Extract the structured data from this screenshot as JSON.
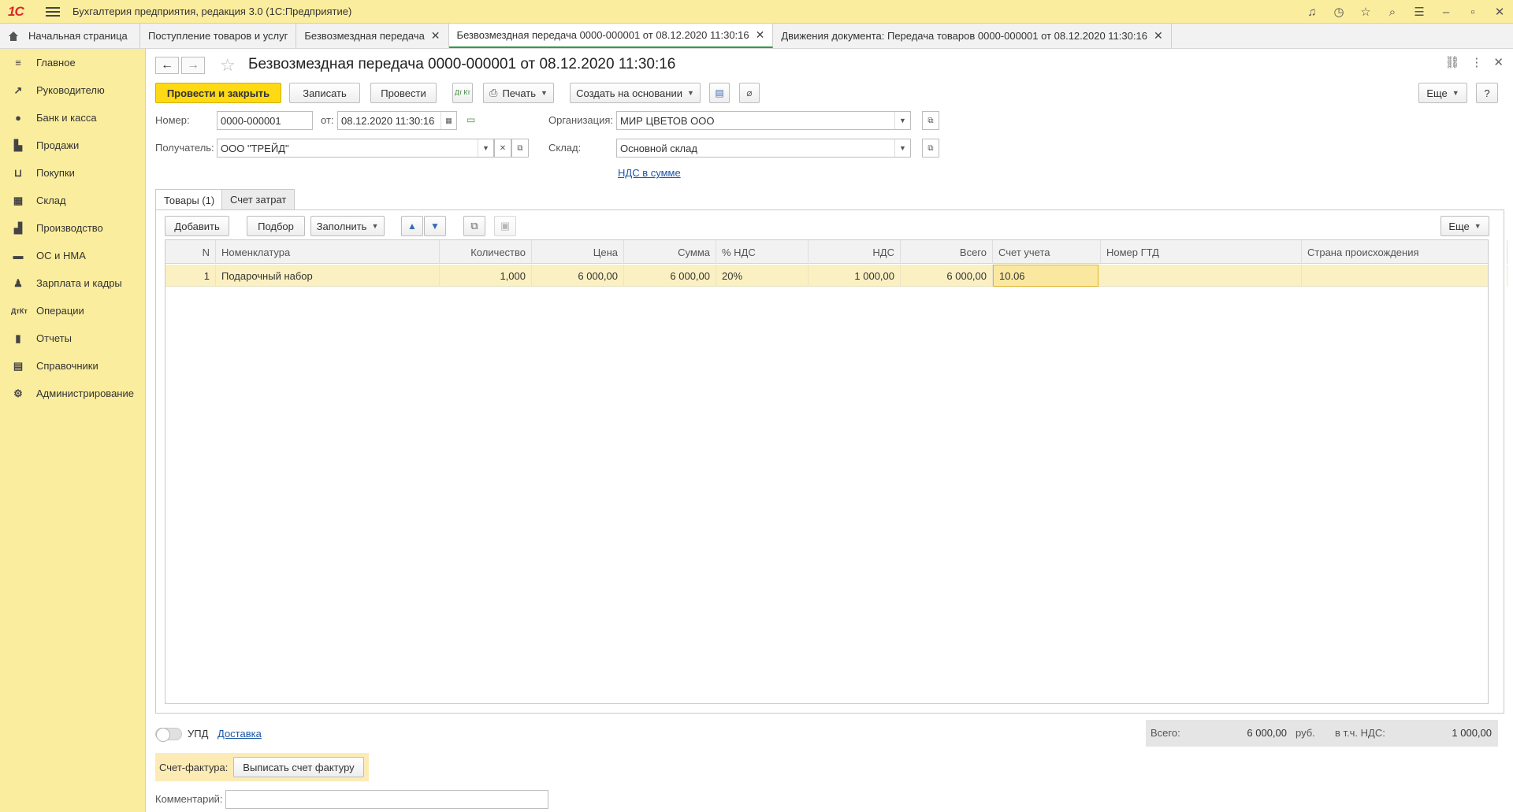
{
  "app": {
    "title": "Бухгалтерия предприятия, редакция 3.0  (1С:Предприятие)",
    "logo": "1С"
  },
  "tabs": [
    {
      "label": "Начальная страница"
    },
    {
      "label": "Поступление товаров и услуг"
    },
    {
      "label": "Безвозмездная передача"
    },
    {
      "label": "Безвозмездная передача 0000-000001 от 08.12.2020 11:30:16"
    },
    {
      "label": "Движения документа: Передача товаров 0000-000001 от 08.12.2020 11:30:16"
    }
  ],
  "sidebar": {
    "items": [
      {
        "label": "Главное",
        "icon": "menu-icon"
      },
      {
        "label": "Руководителю",
        "icon": "trend-icon"
      },
      {
        "label": "Банк и касса",
        "icon": "coin-icon"
      },
      {
        "label": "Продажи",
        "icon": "bag-icon"
      },
      {
        "label": "Покупки",
        "icon": "cart-icon"
      },
      {
        "label": "Склад",
        "icon": "grid-icon"
      },
      {
        "label": "Производство",
        "icon": "factory-icon"
      },
      {
        "label": "ОС и НМА",
        "icon": "truck-icon"
      },
      {
        "label": "Зарплата и кадры",
        "icon": "person-icon"
      },
      {
        "label": "Операции",
        "icon": "dt-kt-icon"
      },
      {
        "label": "Отчеты",
        "icon": "bar-chart-icon"
      },
      {
        "label": "Справочники",
        "icon": "book-icon"
      },
      {
        "label": "Администрирование",
        "icon": "gear-icon"
      }
    ]
  },
  "doc": {
    "title": "Безвозмездная передача 0000-000001 от 08.12.2020 11:30:16"
  },
  "toolbar": {
    "post_close": "Провести и закрыть",
    "save": "Записать",
    "post": "Провести",
    "dtkt": "Дт Кт",
    "print": "Печать",
    "create_based": "Создать на основании",
    "more": "Еще",
    "help": "?"
  },
  "form": {
    "number_label": "Номер:",
    "number": "0000-000001",
    "date_label": "от:",
    "date": "08.12.2020 11:30:16",
    "org_label": "Организация:",
    "org": "МИР ЦВЕТОВ ООО",
    "recipient_label": "Получатель:",
    "recipient": "ООО \"ТРЕЙД\"",
    "warehouse_label": "Склад:",
    "warehouse": "Основной склад",
    "vat_link": "НДС в сумме"
  },
  "form_tabs": [
    {
      "label": "Товары (1)"
    },
    {
      "label": "Счет затрат"
    }
  ],
  "table_toolbar": {
    "add": "Добавить",
    "pick": "Подбор",
    "fill": "Заполнить",
    "more": "Еще"
  },
  "table": {
    "columns": [
      "N",
      "Номенклатура",
      "Количество",
      "Цена",
      "Сумма",
      "% НДС",
      "НДС",
      "Всего",
      "Счет учета",
      "Номер ГТД",
      "Страна происхождения"
    ],
    "rows": [
      {
        "n": "1",
        "item": "Подарочный набор",
        "qty": "1,000",
        "price": "6 000,00",
        "sum": "6 000,00",
        "vat_rate": "20%",
        "vat": "1 000,00",
        "total": "6 000,00",
        "account": "10.06",
        "gtd": "",
        "country": ""
      }
    ]
  },
  "footer": {
    "upd_label": "УПД",
    "delivery_link": "Доставка",
    "total_label": "Всего:",
    "total_value": "6 000,00",
    "currency": "руб.",
    "vat_label": "в т.ч. НДС:",
    "vat_value": "1 000,00",
    "invoice_label": "Счет-фактура:",
    "invoice_button": "Выписать счет фактуру",
    "comment_label": "Комментарий:",
    "comment_value": ""
  }
}
